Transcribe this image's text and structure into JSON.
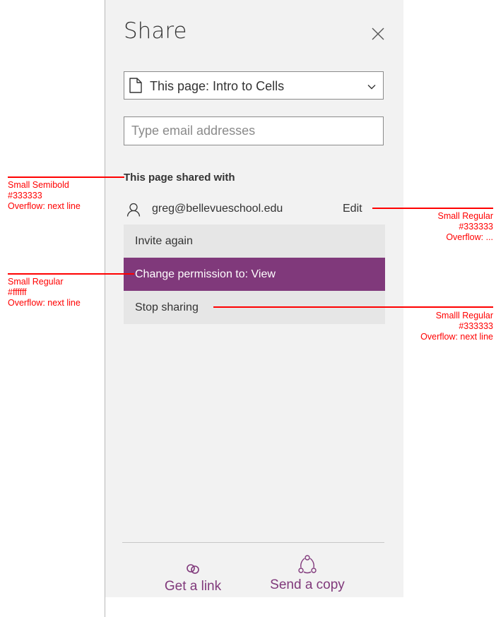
{
  "panel": {
    "title": "Share",
    "scope_select": {
      "label": "This page: Intro to Cells"
    },
    "email_input": {
      "placeholder": "Type email addresses",
      "value": ""
    },
    "shared_heading": "This page shared with",
    "shared_user": {
      "email": "greg@bellevueschool.edu",
      "permission": "Edit"
    },
    "permission_menu": [
      {
        "label": "Invite again"
      },
      {
        "label": "Change permission to: View"
      },
      {
        "label": "Stop sharing"
      }
    ],
    "footer": {
      "get_link_label": "Get a link",
      "send_copy_label": "Send a copy"
    }
  },
  "annotations": {
    "heading": "Small Semibold\n#333333\nOverflow: next line",
    "active_item": "Small Regular\n#ffffff\nOverflow: next line",
    "permission": "Small Regular\n#333333\nOverflow: ...",
    "stop_sharing": "Smalll Regular\n#333333\nOverflow: next line"
  },
  "colors": {
    "accent": "#80397b",
    "text": "#333333",
    "panel_bg": "#f2f2f2",
    "menu_bg": "#e6e6e6",
    "annotation": "#ff0000"
  }
}
